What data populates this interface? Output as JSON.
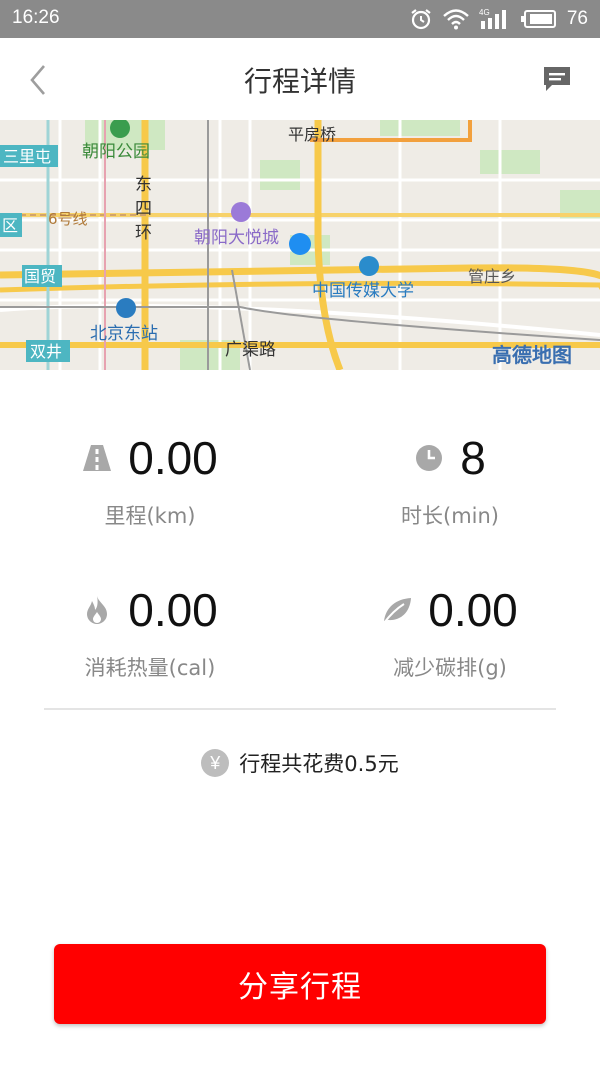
{
  "statusbar": {
    "time": "16:26",
    "battery": "76",
    "network": "4G"
  },
  "header": {
    "title": "行程详情"
  },
  "map": {
    "labels": {
      "sanlitun": "三里屯",
      "chaoyang_park": "朝阳公园",
      "pingfangqiao": "平房桥",
      "dongsihuan": [
        "东",
        "四",
        "环"
      ],
      "line6": "6号线",
      "qu": "区",
      "joy_city": "朝阳大悦城",
      "guomao": "国贸",
      "cuc": "中国传媒大学",
      "guanzhuangxiang": "管庄乡",
      "beijing_east": "北京东站",
      "guangqu_road": "广渠路",
      "shuangjing": "双井",
      "provider": "高德地图"
    }
  },
  "stats": {
    "distance": {
      "value": "0.00",
      "label": "里程(km)"
    },
    "duration": {
      "value": "8",
      "label": "时长(min)"
    },
    "calories": {
      "value": "0.00",
      "label": "消耗热量(cal)"
    },
    "carbon": {
      "value": "0.00",
      "label": "减少碳排(g)"
    }
  },
  "cost": {
    "symbol": "¥",
    "text": "行程共花费0.5元"
  },
  "share": {
    "label": "分享行程"
  }
}
